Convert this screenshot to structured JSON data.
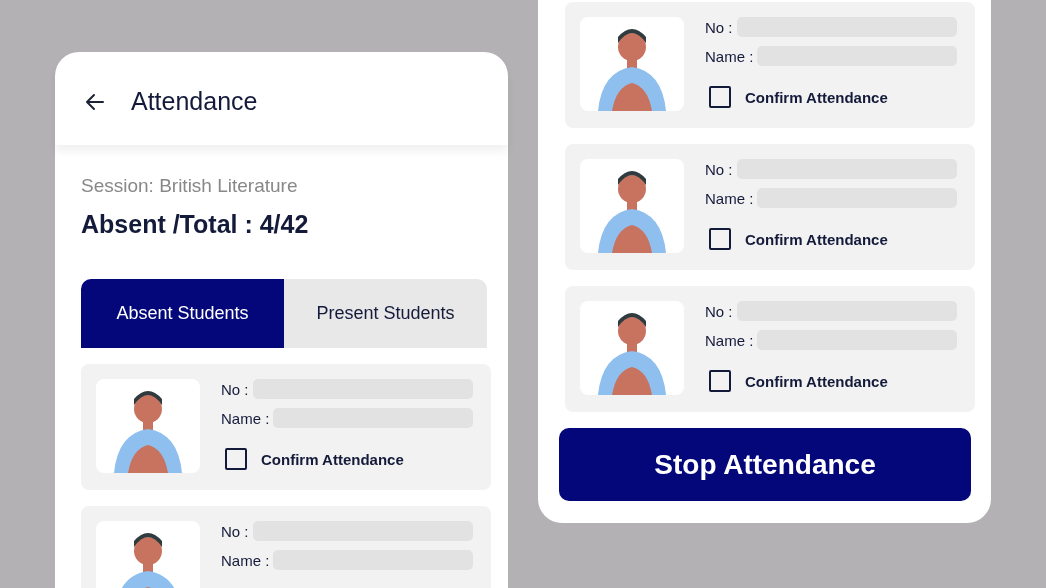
{
  "left_screen": {
    "title": "Attendance",
    "session": "Session: British Literature",
    "summary": "Absent /Total : 4/42",
    "tabs": [
      {
        "label": "Absent Students",
        "selected": true
      },
      {
        "label": "Present Students",
        "selected": false
      }
    ],
    "students": [
      {
        "no_label": "No :",
        "name_label": "Name :",
        "confirm_label": "Confirm Attendance",
        "checked": false
      },
      {
        "no_label": "No :",
        "name_label": "Name :"
      }
    ]
  },
  "right_screen": {
    "students": [
      {
        "no_label": "No :",
        "name_label": "Name :",
        "confirm_label": "Confirm Attendance",
        "checked": false
      },
      {
        "no_label": "No :",
        "name_label": "Name :",
        "confirm_label": "Confirm Attendance",
        "checked": false
      },
      {
        "no_label": "No :",
        "name_label": "Name :",
        "confirm_label": "Confirm Attendance",
        "checked": false
      }
    ],
    "stop_button": "Stop Attendance"
  }
}
